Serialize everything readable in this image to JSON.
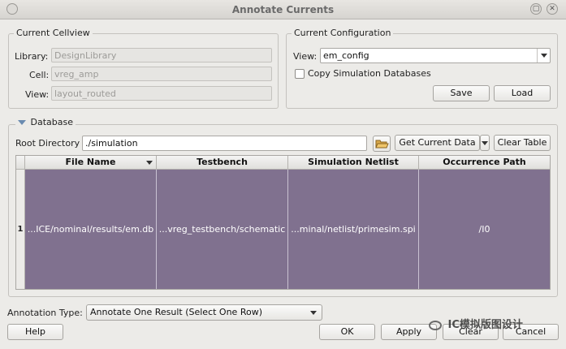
{
  "window": {
    "title": "Annotate Currents",
    "close_glyph": "✕",
    "maximize_glyph": "▢"
  },
  "cellview": {
    "group_title": "Current Cellview",
    "library_label": "Library:",
    "library_value": "DesignLibrary",
    "cell_label": "Cell:",
    "cell_value": "vreg_amp",
    "view_label": "View:",
    "view_value": "layout_routed"
  },
  "configuration": {
    "group_title": "Current Configuration",
    "view_label": "View:",
    "view_value": "em_config",
    "copy_sim_label": "Copy Simulation Databases",
    "copy_sim_checked": false,
    "save_label": "Save",
    "load_label": "Load"
  },
  "database": {
    "section_title": "Database",
    "root_dir_label": "Root Directory",
    "root_dir_value": "./simulation",
    "get_current_data_label": "Get Current Data",
    "clear_table_label": "Clear Table",
    "table": {
      "columns": [
        "File Name",
        "Testbench",
        "Simulation Netlist",
        "Occurrence Path"
      ],
      "rows": [
        {
          "index": "1",
          "cells": [
            "...ICE/nominal/results/em.db",
            "...vreg_testbench/schematic",
            "...minal/netlist/primesim.spi",
            "/I0"
          ]
        }
      ]
    }
  },
  "annotation": {
    "type_label": "Annotation Type:",
    "type_value": "Annotate One Result (Select One Row)"
  },
  "footer": {
    "help_label": "Help",
    "ok_label": "OK",
    "apply_label": "Apply",
    "clear_label": "Clear",
    "cancel_label": "Cancel"
  },
  "watermark": {
    "text": "IC模拟版图设计"
  },
  "icons": {
    "folder": "folder-icon",
    "expand": "triangle-down-icon",
    "dropdown": "chevron-down-icon",
    "sort": "sort-desc-icon"
  },
  "colors": {
    "selected_row": "#80718f",
    "window_bg": "#ecebe8"
  }
}
